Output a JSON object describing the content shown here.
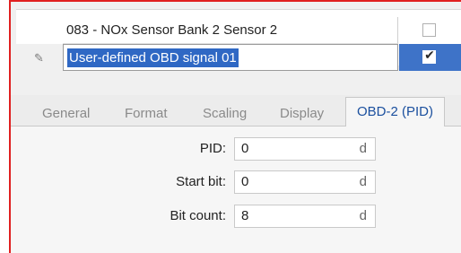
{
  "grid": {
    "rows": [
      {
        "name": "083 - NOx Sensor Bank 2 Sensor 2",
        "checked": false,
        "selected": false
      },
      {
        "name": "User-defined OBD signal 01",
        "checked": true,
        "selected": true
      }
    ],
    "edit_icon": "pencil-icon",
    "selection_color": "#2f68c4"
  },
  "tabs": [
    {
      "label": "General",
      "active": false
    },
    {
      "label": "Format",
      "active": false
    },
    {
      "label": "Scaling",
      "active": false
    },
    {
      "label": "Display",
      "active": false
    },
    {
      "label": "OBD-2 (PID)",
      "active": true
    }
  ],
  "form": {
    "pid": {
      "label": "PID:",
      "value": "0",
      "unit": "d"
    },
    "start_bit": {
      "label": "Start bit:",
      "value": "0",
      "unit": "d"
    },
    "bit_count": {
      "label": "Bit count:",
      "value": "8",
      "unit": "d"
    }
  },
  "colors": {
    "accent_tab_text": "#1a4f9e",
    "frame": "#e02020"
  }
}
